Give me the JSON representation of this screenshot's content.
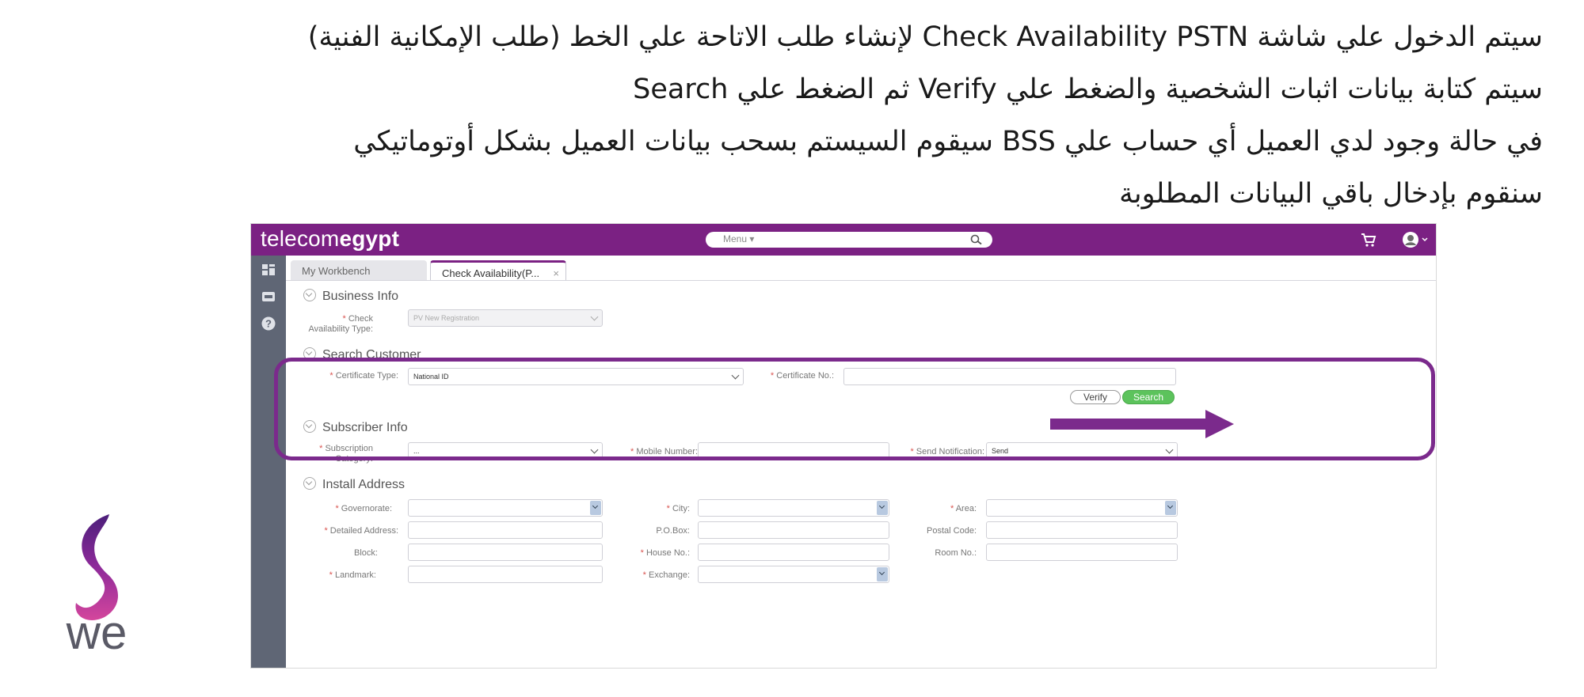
{
  "instructions": {
    "line1": "سيتم الدخول علي شاشة Check Availability PSTN لإنشاء طلب الاتاحة علي الخط (طلب الإمكانية الفنية)",
    "line2": "سيتم كتابة بيانات اثبات الشخصية والضغط علي Verify ثم الضغط علي Search",
    "line3": "في حالة وجود لدي العميل أي حساب علي BSS سيقوم السيستم بسحب بيانات العميل بشكل أوتوماتيكي",
    "line4": "سنقوم بإدخال باقي البيانات المطلوبة"
  },
  "logo": {
    "text": "we",
    "colors": {
      "purple": "#7b2183",
      "magenta": "#c2389b",
      "gray": "#5a5a66"
    }
  },
  "app": {
    "brand": {
      "part1": "telecom",
      "part2": "egypt"
    },
    "menu_label": "Menu ▾",
    "icons": {
      "search": "search-icon",
      "cart": "cart-icon",
      "user": "user-avatar-icon"
    },
    "nav_icons": [
      "dashboard-icon",
      "inbox-icon",
      "help-icon"
    ],
    "tabs": [
      {
        "label": "My Workbench"
      },
      {
        "label": "Check Availability(P...",
        "close": "×"
      }
    ],
    "business_info": {
      "title": "Business Info",
      "check_type_label": "Check Availability Type:",
      "check_type_value": "PV New Registration"
    },
    "search_customer": {
      "title": "Search Customer",
      "certificate_type_label": "Certificate Type:",
      "certificate_type_value": "National ID",
      "certificate_no_label": "Certificate No.:",
      "certificate_no_value": "",
      "verify_label": "Verify",
      "search_label": "Search"
    },
    "subscriber_info": {
      "title": "Subscriber Info",
      "subscription_category_label": "Subscription Category:",
      "subscription_category_value": "...",
      "mobile_number_label": "Mobile Number:",
      "mobile_number_value": "",
      "send_notification_label": "Send Notification:",
      "send_notification_value": "Send"
    },
    "install_address": {
      "title": "Install Address",
      "governorate_label": "Governorate:",
      "city_label": "City:",
      "area_label": "Area:",
      "detailed_address_label": "Detailed Address:",
      "po_box_label": "P.O.Box:",
      "postal_code_label": "Postal Code:",
      "block_label": "Block:",
      "house_no_label": "House No.:",
      "room_no_label": "Room No.:",
      "landmark_label": "Landmark:",
      "exchange_label": "Exchange:"
    },
    "colors": {
      "brand_purple": "#7b2183",
      "highlight": "#7b2a8c",
      "search_green": "#5cc35c",
      "nav_gray": "#5f6675"
    }
  }
}
